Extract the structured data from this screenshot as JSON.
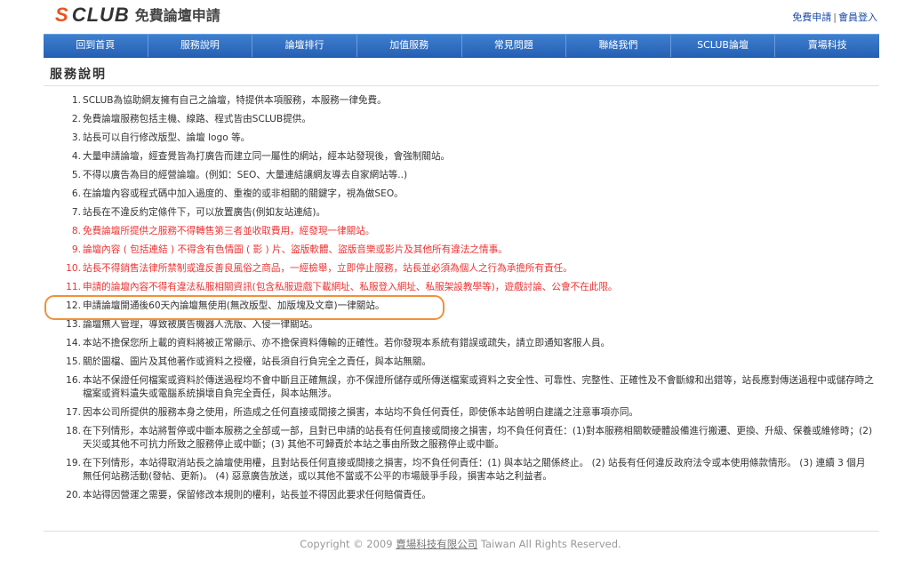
{
  "header": {
    "logo_s": "S",
    "logo_club": "CLUB",
    "logo_title": "免費論壇申請",
    "links": [
      {
        "label": "免費申請"
      },
      {
        "label": "會員登入"
      }
    ],
    "link_separator": "|"
  },
  "nav": {
    "items": [
      {
        "label": "回到首頁"
      },
      {
        "label": "服務說明"
      },
      {
        "label": "論壇排行"
      },
      {
        "label": "加值服務"
      },
      {
        "label": "常見問題"
      },
      {
        "label": "聯絡我們"
      },
      {
        "label": "SCLUB論壇"
      },
      {
        "label": "賣場科技"
      }
    ]
  },
  "page": {
    "title": "服務說明",
    "terms": [
      {
        "n": "1.",
        "text": "SCLUB為協助網友擁有自己之論壇，特提供本項服務，本服務一律免費。"
      },
      {
        "n": "2.",
        "text": "免費論壇服務包括主機、線路、程式皆由SCLUB提供。"
      },
      {
        "n": "3.",
        "text": "站長可以自行修改版型、論壇 logo 等。"
      },
      {
        "n": "4.",
        "text": "大量申請論壇，經查覺皆為打廣告而建立同一屬性的網站，經本站發現後，會強制關站。"
      },
      {
        "n": "5.",
        "text": "不得以廣告為目的經營論壇。(例如：SEO、大量連結讓網友導去自家網站等..)"
      },
      {
        "n": "6.",
        "text": "在論壇內容或程式碼中加入過度的、重複的或非相關的關鍵字，視為做SEO。"
      },
      {
        "n": "7.",
        "text": "站長在不違反約定條件下，可以放置廣告(例如友站連結)。"
      },
      {
        "n": "8.",
        "text": "免費論壇所提供之服務不得轉售第三者並收取費用，經發現一律關站。"
      },
      {
        "n": "9.",
        "text": "論壇內容 ( 包括連結 ) 不得含有色情圖 ( 影 ) 片、盜版軟體、盜版音樂或影片及其他所有違法之情事。"
      },
      {
        "n": "10.",
        "text": "站長不得銷售法律所禁制或違反善良風俗之商品，一經檢舉，立即停止服務，站長並必須為個人之行為承擔所有責任。"
      },
      {
        "n": "11.",
        "text": "申請的論壇內容不得有違法私服相關資訊(包含私服遊戲下載網址、私服登入網址、私服架設教學等)，遊戲討論、公會不在此限。"
      },
      {
        "n": "12.",
        "text": "申請論壇開通後60天內論壇無使用(無改版型、加版塊及文章)一律關站。"
      },
      {
        "n": "13.",
        "text": "論壇無人管理，導致被廣告機器人洗版、入侵一律關站。"
      },
      {
        "n": "14.",
        "text": "本站不擔保您所上載的資料將被正常顯示、亦不擔保資料傳輸的正確性。若你發現本系統有錯誤或疏失，請立即通知客服人員。"
      },
      {
        "n": "15.",
        "text": "關於圖檔、圖片及其他著作或資料之授權，站長須自行負完全之責任，與本站無關。"
      },
      {
        "n": "16.",
        "text": "本站不保證任何檔案或資料於傳送過程均不會中斷且正確無誤，亦不保證所儲存或所傳送檔案或資料之安全性、可靠性、完整性、正確性及不會斷線和出錯等，站長應對傳送過程中或儲存時之檔案或資料遺失或電腦系統損壞自負完全責任，與本站無涉。"
      },
      {
        "n": "17.",
        "text": "因本公司所提供的服務本身之使用，所造成之任何直接或間接之損害，本站均不負任何責任，即使係本站曾明白建議之注意事項亦同。"
      },
      {
        "n": "18.",
        "text": "在下列情形，本站將暫停或中斷本服務之全部或一部，且對已申請的站長有任何直接或間接之損害，均不負任何責任：(1)對本服務相關軟硬體設備進行搬遷、更換、升級、保養或維修時；(2) 天災或其他不可抗力所致之服務停止或中斷；(3) 其他不可歸責於本站之事由所致之服務停止或中斷。"
      },
      {
        "n": "19.",
        "text": "在下列情形，本站得取消站長之論壇使用權，且對站長任何直接或間接之損害，均不負任何責任：(1) 與本站之關係終止。 (2) 站長有任何違反政府法令或本使用條款情形。 (3) 連續 3 個月無任何站務活動(發帖、更新)。 (4) 惡意廣告放送，或以其他不當或不公平的市場競爭手段，損害本站之利益者。"
      },
      {
        "n": "20.",
        "text": "本站得因營運之需要，保留修改本規則的權利，站長並不得因此要求任何賠償責任。"
      }
    ]
  },
  "footer": {
    "prefix": "Copyright © 2009",
    "company": "賣場科技有限公司",
    "suffix": "Taiwan All Rights Reserved."
  },
  "colors": {
    "nav_bg": "#2d6bbf",
    "warning_text": "#e33333",
    "highlight_border": "#f0913a",
    "logo_accent": "#e8531f"
  }
}
